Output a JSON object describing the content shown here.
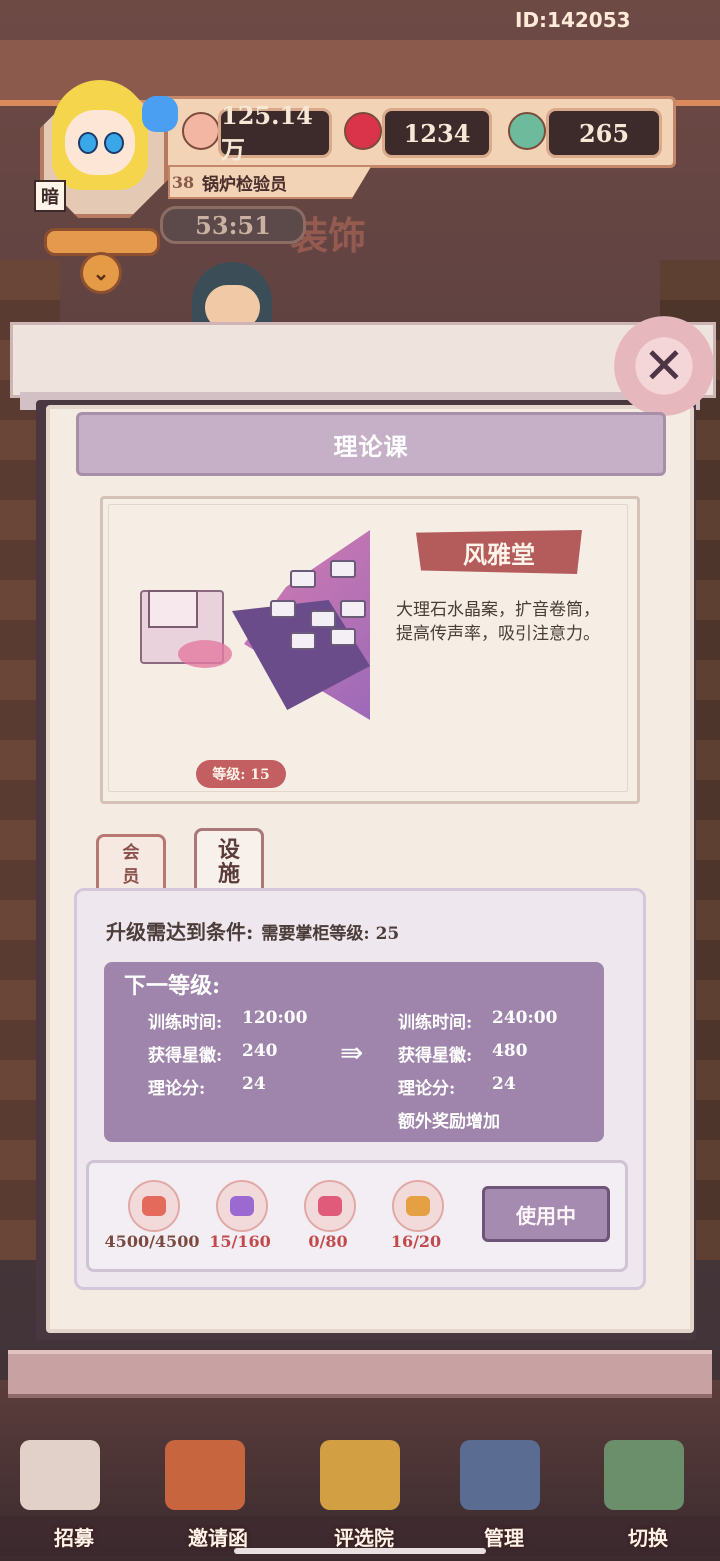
{
  "account_id": "ID:142053",
  "player": {
    "level": "38",
    "title": "锅炉检验员",
    "mode_tag": "暗",
    "timer": "53:51"
  },
  "resources": [
    {
      "name": "heart-currency",
      "value": "125.14万",
      "icon": "heart-coin-icon",
      "color": "#e46b5b"
    },
    {
      "name": "red-gem",
      "value": "1234",
      "icon": "red-gem-icon",
      "color": "#d9344a"
    },
    {
      "name": "jade-coin",
      "value": "265",
      "icon": "jade-coin-icon",
      "color": "#6dbb9c"
    }
  ],
  "background_sign": "装饰",
  "dialog": {
    "title": "理论课",
    "facility_name": "风雅堂",
    "description": "大理石水晶案，扩音卷筒，提高传声率，吸引注意力。",
    "level_label": "等级: 15",
    "tabs": [
      {
        "label": "会员"
      },
      {
        "label": "设施"
      }
    ],
    "requirement_label": "升级需达到条件:",
    "requirement_detail": "需要掌柜等级: 25",
    "next_level_title": "下一等级:",
    "current_stats": [
      {
        "label": "训练时间:",
        "value": "120:00"
      },
      {
        "label": "获得星徽:",
        "value": "240"
      },
      {
        "label": "理论分:",
        "value": "24"
      }
    ],
    "next_stats": [
      {
        "label": "训练时间:",
        "value": "240:00"
      },
      {
        "label": "获得星徽:",
        "value": "480"
      },
      {
        "label": "理论分:",
        "value": "24"
      }
    ],
    "extra_bonus": "额外奖励增加",
    "costs": [
      {
        "icon": "heart-coin-icon",
        "value": "4500/4500",
        "color": "#7a4a40"
      },
      {
        "icon": "purple-crystal-icon",
        "value": "15/160",
        "color": "#c24a4a"
      },
      {
        "icon": "pink-crystal-icon",
        "value": "0/80",
        "color": "#c24a4a"
      },
      {
        "icon": "gold-crystal-icon",
        "value": "16/20",
        "color": "#c24a4a"
      }
    ],
    "use_button": "使用中"
  },
  "nav": [
    {
      "label": "招募",
      "icon": "recruit-icon"
    },
    {
      "label": "邀请函",
      "icon": "invitation-icon"
    },
    {
      "label": "评选院",
      "icon": "selection-hall-icon"
    },
    {
      "label": "管理",
      "icon": "manage-icon"
    },
    {
      "label": "切换",
      "icon": "switch-map-icon"
    }
  ]
}
